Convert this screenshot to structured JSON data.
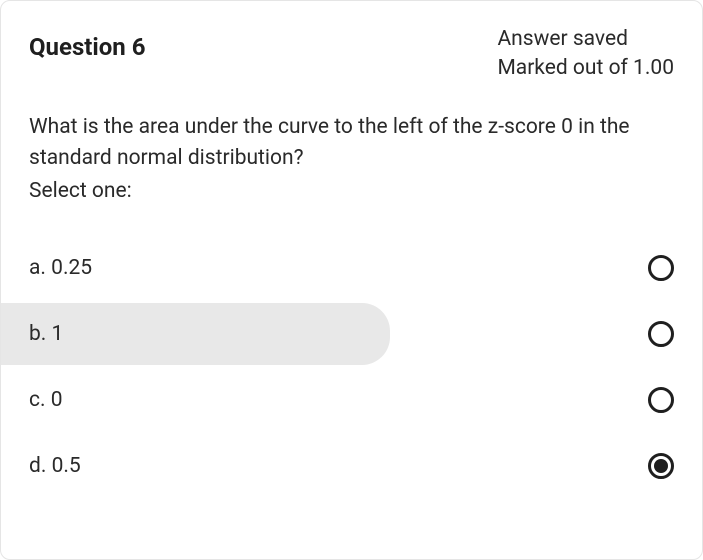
{
  "header": {
    "title": "Question 6",
    "status_saved": "Answer saved",
    "status_marks": "Marked out of 1.00"
  },
  "question": {
    "text": "What is the area under the curve to the left of the z-score 0 in the standard normal distribution?",
    "select_one": "Select one:"
  },
  "options": [
    {
      "label": "a. 0.25",
      "selected": false,
      "highlighted": false
    },
    {
      "label": "b. 1",
      "selected": false,
      "highlighted": true
    },
    {
      "label": "c. 0",
      "selected": false,
      "highlighted": false
    },
    {
      "label": "d. 0.5",
      "selected": true,
      "highlighted": false
    }
  ]
}
